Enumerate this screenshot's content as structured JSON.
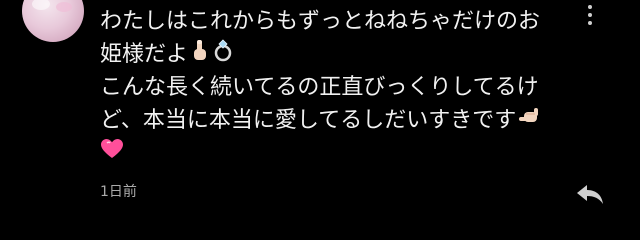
{
  "comment": {
    "lines": [
      "わたしはこれからもずっとねねちゃだけのお",
      "姫様だよ",
      "こんな長く続いてるの正直びっくりしてるけ",
      "ど、本当に本当に愛してるしだいすきです"
    ],
    "emojis": [
      "index-pointing-up-icon",
      "ring-icon",
      "call-me-hand-icon",
      "heart-icon"
    ]
  },
  "timestamp": "1日前",
  "colors": {
    "background": "#000000",
    "text": "#f1f1f1",
    "timestamp": "#aaaaaa",
    "icon": "#cfcfcf",
    "heart": "#ff4f9a"
  }
}
